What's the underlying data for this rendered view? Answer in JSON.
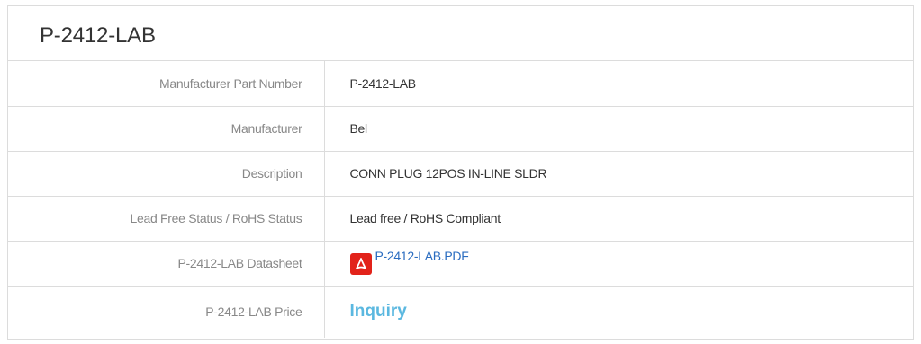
{
  "product": {
    "title": "P-2412-LAB"
  },
  "specs": {
    "mpn": {
      "label": "Manufacturer Part Number",
      "value": "P-2412-LAB"
    },
    "manufacturer": {
      "label": "Manufacturer",
      "value": "Bel"
    },
    "description": {
      "label": "Description",
      "value": "CONN PLUG 12POS IN-LINE SLDR"
    },
    "rohs": {
      "label": "Lead Free Status / RoHS Status",
      "value": "Lead free / RoHS Compliant"
    },
    "datasheet": {
      "label": "P-2412-LAB Datasheet",
      "link_text": "P-2412-LAB.PDF",
      "icon": "pdf-icon"
    },
    "price": {
      "label": "P-2412-LAB Price",
      "value": "Inquiry"
    }
  },
  "colors": {
    "border": "#dcdcdc",
    "label_text": "#888888",
    "value_text": "#333333",
    "link": "#2a6cc0",
    "price": "#5bb8e0",
    "pdf_icon": "#e2231a"
  }
}
